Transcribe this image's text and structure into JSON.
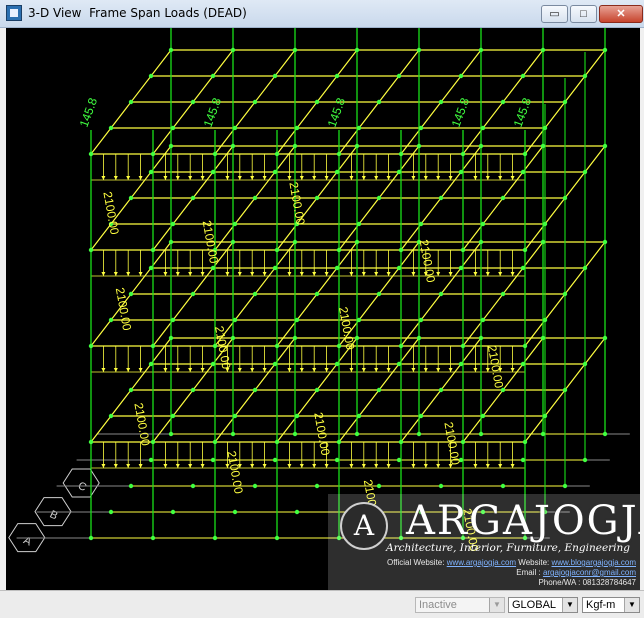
{
  "window": {
    "title": "3-D View  Frame Span Loads (DEAD)",
    "buttons": {
      "minimize": "▭",
      "maximize": "□",
      "close": "✕"
    }
  },
  "loads": {
    "point_label": "145.8",
    "span_label": "2100.00",
    "grid_bubbles": [
      "A",
      "B",
      "C"
    ],
    "colors": {
      "frame": "#ffff40",
      "column": "#18e018",
      "joint": "#40ff40",
      "text_yellow": "#ffff40",
      "text_green": "#40ff40",
      "background": "#000000"
    }
  },
  "watermark": {
    "logo_letter": "A",
    "brand": "ARGAJOGJA",
    "tagline": "Architecture, Interior, Furniture, Engineering",
    "website_prefix": "Official Website: ",
    "website": "www.argajogja.com",
    "website2_prefix": " Website: ",
    "website2": "www.blogargajogja.com",
    "email_prefix": "Email : ",
    "email": "argajogjaconr@gmail.com",
    "phone": "Phone/WA : 081328784647"
  },
  "statusbar": {
    "status_combo": "Inactive",
    "coord_combo": "GLOBAL",
    "units_combo": "Kgf-m"
  }
}
